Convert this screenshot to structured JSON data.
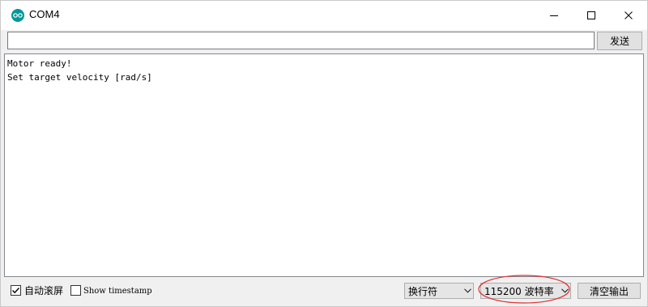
{
  "window": {
    "title": "COM4",
    "app_icon": "arduino-icon",
    "controls": [
      "minimize-icon",
      "maximize-icon",
      "close-icon"
    ]
  },
  "send_bar": {
    "input_value": "",
    "input_placeholder": "",
    "send_label": "发送"
  },
  "output": {
    "lines": [
      "Motor ready!",
      "Set target velocity [rad/s]"
    ]
  },
  "bottom_bar": {
    "autoscroll": {
      "label": "自动滚屏",
      "checked": true
    },
    "timestamp": {
      "label": "Show timestamp",
      "checked": false
    },
    "line_ending": {
      "selected": "换行符"
    },
    "baud_rate": {
      "selected": "115200 波特率"
    },
    "clear_label": "清空输出"
  },
  "colors": {
    "app_icon": "#00979c",
    "annotation_circle": "#e03030"
  }
}
